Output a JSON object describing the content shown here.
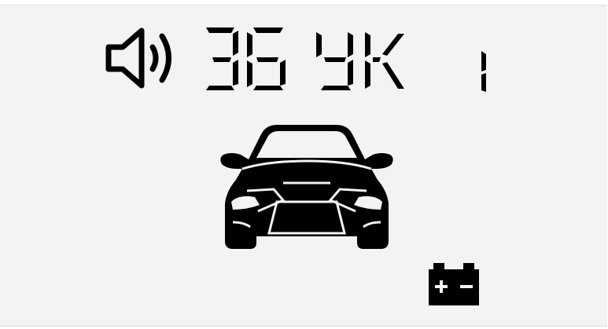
{
  "display": {
    "mode_readout": "36 YK",
    "channel_readout": "1"
  },
  "icons": {
    "sound": "speaker-icon",
    "vehicle": "car-icon",
    "power": "battery-icon"
  },
  "colors": {
    "background": "#f3f3f3",
    "segment": "#000000"
  }
}
